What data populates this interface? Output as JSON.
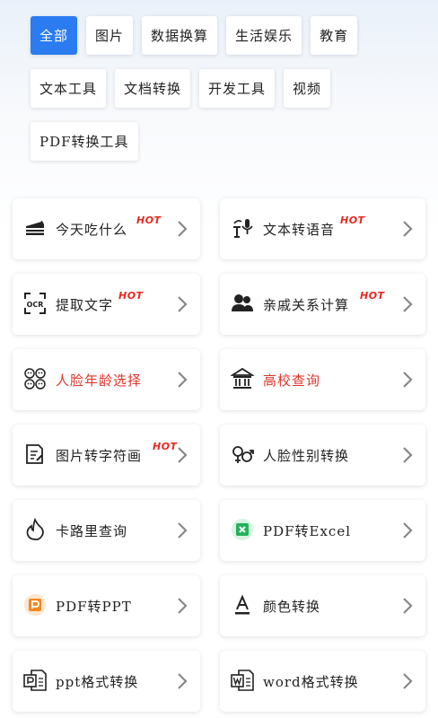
{
  "categories": [
    {
      "label": "全部",
      "active": true
    },
    {
      "label": "图片",
      "active": false
    },
    {
      "label": "数据换算",
      "active": false
    },
    {
      "label": "生活娱乐",
      "active": false
    },
    {
      "label": "教育",
      "active": false
    },
    {
      "label": "文本工具",
      "active": false
    },
    {
      "label": "文档转换",
      "active": false
    },
    {
      "label": "开发工具",
      "active": false
    },
    {
      "label": "视频",
      "active": false
    },
    {
      "label": "PDF转换工具",
      "active": false
    }
  ],
  "tools": [
    {
      "label": "今天吃什么",
      "hot": "HOT",
      "icon": "cake-icon",
      "red": false
    },
    {
      "label": "文本转语音",
      "hot": "HOT",
      "icon": "text-to-speech-icon",
      "red": false
    },
    {
      "label": "提取文字",
      "hot": "HOT",
      "icon": "ocr-icon",
      "red": false
    },
    {
      "label": "亲戚关系计算",
      "hot": "HOT",
      "icon": "relatives-icon",
      "red": false
    },
    {
      "label": "人脸年龄选择",
      "hot": "",
      "icon": "face-age-icon",
      "red": true
    },
    {
      "label": "高校查询",
      "hot": "",
      "icon": "university-icon",
      "red": true
    },
    {
      "label": "图片转字符画",
      "hot": "HOT",
      "icon": "image-to-ascii-icon",
      "red": false
    },
    {
      "label": "人脸性别转换",
      "hot": "",
      "icon": "gender-icon",
      "red": false
    },
    {
      "label": "卡路里查询",
      "hot": "",
      "icon": "flame-icon",
      "red": false
    },
    {
      "label": "PDF转Excel",
      "hot": "",
      "icon": "pdf-excel-icon",
      "red": false
    },
    {
      "label": "PDF转PPT",
      "hot": "",
      "icon": "pdf-ppt-icon",
      "red": false
    },
    {
      "label": "颜色转换",
      "hot": "",
      "icon": "font-color-icon",
      "red": false
    },
    {
      "label": "ppt格式转换",
      "hot": "",
      "icon": "ppt-file-icon",
      "red": false
    },
    {
      "label": "word格式转换",
      "hot": "",
      "icon": "word-file-icon",
      "red": false
    }
  ],
  "colors": {
    "accent": "#2a7cf0",
    "hot": "#e8271e",
    "red_label": "#e0352b",
    "excel_green": "#21b35a",
    "ppt_orange": "#f08a24"
  }
}
